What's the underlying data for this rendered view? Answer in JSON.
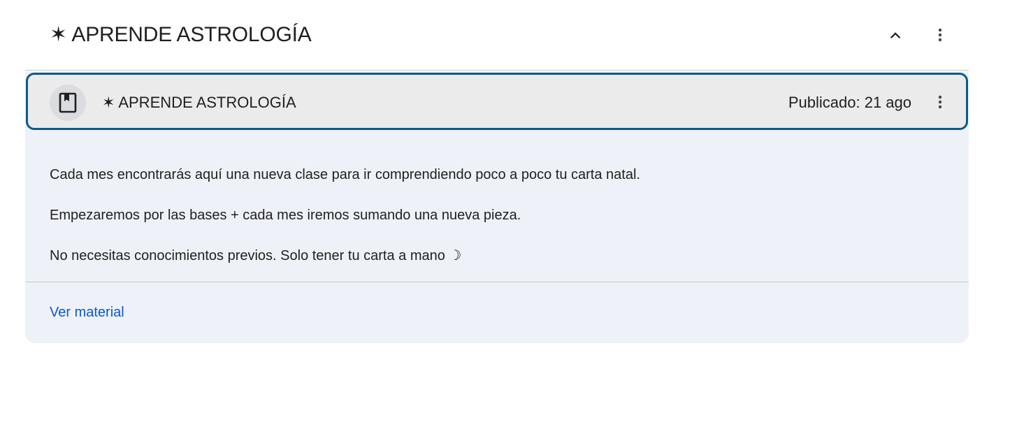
{
  "topic": {
    "title": "✶ APRENDE ASTROLOGÍA",
    "collapse_icon": "chevron-up-icon",
    "more_icon": "more-vert-icon"
  },
  "item": {
    "icon": "book-material-icon",
    "title": "✶ APRENDE ASTROLOGÍA",
    "published": "Publicado: 21 ago",
    "more_icon": "more-vert-icon"
  },
  "body": {
    "paragraphs": [
      "Cada mes encontrarás aquí una nueva clase para ir comprendiendo poco a poco tu carta natal.",
      "Empezaremos por las bases + cada mes iremos sumando una nueva pieza.",
      "No necesitas conocimientos previos. Solo tener tu carta a mano ☽"
    ]
  },
  "footer": {
    "link_label": "Ver material"
  },
  "colors": {
    "focus_border": "#0b5a8a",
    "link": "#0b57d0",
    "card_background": "#eef2f8",
    "row_background": "#ebebeb"
  }
}
